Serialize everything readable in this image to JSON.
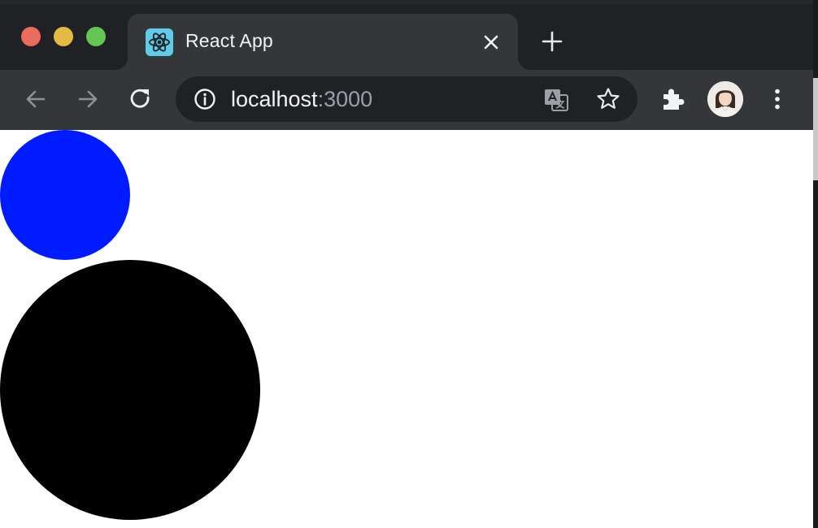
{
  "browser": {
    "tab": {
      "title": "React App",
      "favicon": "react-logo-icon"
    },
    "address_bar": {
      "host": "localhost",
      "port": ":3000"
    },
    "icons": {
      "back": "arrow-left-icon",
      "forward": "arrow-right-icon",
      "reload": "reload-icon",
      "site_info": "info-icon",
      "translate": "translate-icon",
      "bookmark": "star-icon",
      "extensions": "puzzle-icon",
      "profile": "avatar",
      "menu": "kebab-menu-icon",
      "close_tab": "close-icon",
      "new_tab": "plus-icon"
    },
    "colors": {
      "titlebar": "#202124",
      "toolbar": "#35363a",
      "omnibox": "#202124",
      "close": "#ed6a5e",
      "minimize": "#e3bb43",
      "maximize": "#62c554"
    }
  },
  "page": {
    "background": "#ffffff",
    "shapes": [
      {
        "name": "circle-blue",
        "color": "#001bff"
      },
      {
        "name": "circle-black",
        "color": "#000000"
      }
    ]
  }
}
